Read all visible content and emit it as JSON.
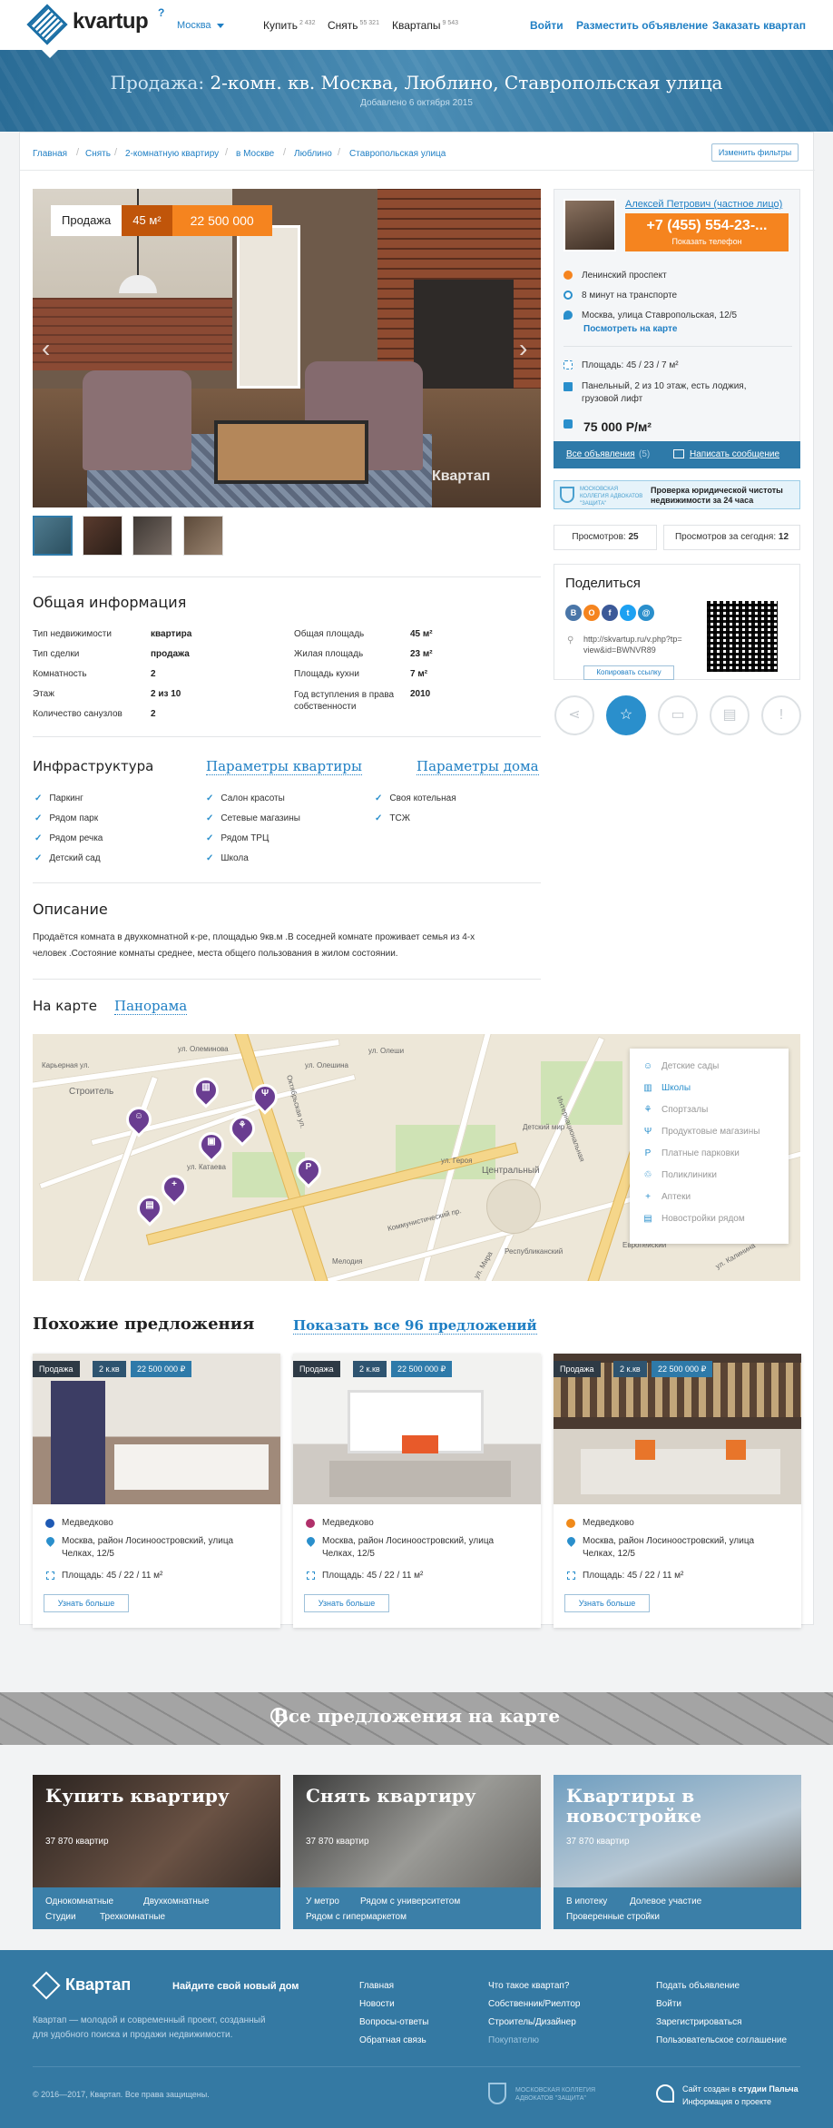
{
  "header": {
    "logo": "kvartup",
    "logo_mark": "?",
    "city": "Москва",
    "nav": [
      {
        "label": "Купить",
        "count": "2 432"
      },
      {
        "label": "Снять",
        "count": "55 321"
      },
      {
        "label": "Квартапы",
        "count": "9 543"
      }
    ],
    "links": [
      "Войти",
      "Разместить объявление",
      "Заказать квартап"
    ]
  },
  "hero": {
    "prefix": "Продажа:",
    "title": "2-комн. кв. Москва, Люблино, Ставропольская улица",
    "date": "Добавлено 6 октября 2015"
  },
  "breadcrumbs": [
    "Главная",
    "Снять",
    "2-комнатную квартиру",
    "в Москве",
    "Люблино",
    "Ставропольская улица"
  ],
  "filters_button": "Изменить фильтры",
  "photo": {
    "deal": "Продажа",
    "area": "45 м²",
    "price": "22 500 000",
    "watermark": "Квартап",
    "prev": "‹",
    "next": "›"
  },
  "agent": {
    "name": "Алексей Петрович (частное лицо)",
    "phone": "+7 (455) 554-23-...",
    "phone_hint": "Показать телефон",
    "metro": "Ленинский проспект",
    "transport": "8 минут на транспорте",
    "address": "Москва, улица Ставропольская, 12/5",
    "map_link": "Посмотреть на карте",
    "area": "Площадь: 45 / 23 / 7 м²",
    "building": "Панельный, 2 из 10 этаж, есть лоджия, грузовой лифт",
    "price_m2": "75 000 Р/м²",
    "all_ads": "Все объявления",
    "all_ads_count": "(5)",
    "write": "Написать сообщение"
  },
  "legal": {
    "logo": "МОСКОВСКАЯ КОЛЛЕГИЯ АДВОКАТОВ \"ЗАЩИТА\"",
    "text": "Проверка юридической чистоты недвижимости за 24 часа"
  },
  "views": {
    "total_label": "Просмотров:",
    "total": "25",
    "today_label": "Просмотров за сегодня:",
    "today": "12"
  },
  "share": {
    "title": "Поделиться",
    "url": "http://skvartup.ru/v.php?tp= view&id=BWNVR89",
    "copy": "Копировать ссылку",
    "icons": [
      "В",
      "О",
      "f",
      "t",
      "@"
    ]
  },
  "actions": [
    "share-icon",
    "star-icon",
    "car-icon",
    "note-icon",
    "alert-icon"
  ],
  "general": {
    "title": "Общая информация",
    "left": [
      [
        "Тип недвижимости",
        "квартира"
      ],
      [
        "Тип сделки",
        "продажа"
      ],
      [
        "Комнатность",
        "2"
      ],
      [
        "Этаж",
        "2 из 10"
      ],
      [
        "Количество санузлов",
        "2"
      ]
    ],
    "right": [
      [
        "Общая площадь",
        "45 м²"
      ],
      [
        "Жилая площадь",
        "23 м²"
      ],
      [
        "Площадь кухни",
        "7 м²"
      ],
      [
        "Год вступления в права собственности",
        "2010"
      ]
    ]
  },
  "infra": {
    "tabs": [
      "Инфраструктура",
      "Параметры квартиры",
      "Параметры дома"
    ],
    "col1": [
      "Паркинг",
      "Рядом парк",
      "Рядом речка",
      "Детский сад"
    ],
    "col2": [
      "Салон красоты",
      "Сетевые магазины",
      "Рядом ТРЦ",
      "Школа"
    ],
    "col3": [
      "Своя котельная",
      "ТСЖ"
    ]
  },
  "description": {
    "title": "Описание",
    "text": "Продаётся комната в двухкомнатной к-ре, площадью 9кв.м .В соседней комнате проживает семья из 4-х человек .Состояние комнаты среднее, места общего пользования в жилом состоянии."
  },
  "map": {
    "tabs": [
      "На карте",
      "Панорама"
    ],
    "legend": [
      "Детские сады",
      "Школы",
      "Спортзалы",
      "Продуктовые магазины",
      "Платные парковки",
      "Поликлиники",
      "Аптеки",
      "Новостройки рядом"
    ],
    "labels": [
      "ул. Олеши",
      "Строитель",
      "ул. Олеминова",
      "ул. Катаева",
      "Октябрьская ул.",
      "ул. Олешина",
      "ул. Героя",
      "Центральный",
      "Коммунистический пр.",
      "Интернациональная",
      "Детский мир",
      "Европейский",
      "Республиканский",
      "ул. Калинина",
      "ул. Мира",
      "Карьерная ул.",
      "Мелодия"
    ]
  },
  "similar": {
    "title": "Похожие предложения",
    "link": "Показать все 96 предложений",
    "items": [
      {
        "deal": "Продажа",
        "rooms": "2 к.кв",
        "price": "22 500 000 ₽",
        "metro": "Медведково",
        "metro_color": "#1f5ab4",
        "address": "Москва, район Лосиноостровский, улица Челках, 12/5",
        "area": "Площадь: 45 / 22 / 11 м²",
        "button": "Узнать больше"
      },
      {
        "deal": "Продажа",
        "rooms": "2 к.кв",
        "price": "22 500 000 ₽",
        "metro": "Медведково",
        "metro_color": "#b0306a",
        "address": "Москва, район Лосиноостровский, улица Челках, 12/5",
        "area": "Площадь: 45 / 22 / 11 м²",
        "button": "Узнать больше"
      },
      {
        "deal": "Продажа",
        "rooms": "2 к.кв",
        "price": "22 500 000 ₽",
        "metro": "Медведково",
        "metro_color": "#f08a1a",
        "address": "Москва, район Лосиноостровский, улица Челках, 12/5",
        "area": "Площадь: 45 / 22 / 11 м²",
        "button": "Узнать больше"
      }
    ]
  },
  "banner": "Все предложения на карте",
  "categories": [
    {
      "title": "Купить квартиру",
      "count": "37 870 квартир",
      "links": [
        "Однокомнатные",
        "Двухкомнатные",
        "Студии",
        "Трехкомнатные"
      ]
    },
    {
      "title": "Снять квартиру",
      "count": "37 870 квартир",
      "links": [
        "У метро",
        "Рядом с университетом",
        "Рядом с гипермаркетом"
      ]
    },
    {
      "title": "Квартиры в новостройке",
      "count": "37 870 квартир",
      "links": [
        "В ипотеку",
        "Долевое участие",
        "Проверенные стройки"
      ]
    }
  ],
  "footer": {
    "logo": "Квартап",
    "slogan": "Найдите свой новый дом",
    "about": "Квартап — молодой и современный проект, созданный для удобного поиска и продажи недвижимости.",
    "col1": [
      "Главная",
      "Новости",
      "Вопросы-ответы",
      "Обратная связь"
    ],
    "col2": [
      "Что такое квартап?",
      "Собственник/Риелтор",
      "Строитель/Дизайнер",
      "Покупателю"
    ],
    "col3": [
      "Подать объявление",
      "Войти",
      "Зарегистрироваться",
      "Пользовательское соглашение"
    ],
    "copyright": "© 2016—2017, Квартап. Все права защищены.",
    "partner": "МОСКОВСКАЯ КОЛЛЕГИЯ АДВОКАТОВ \"ЗАЩИТА\"",
    "made_prefix": "Сайт создан в",
    "made_studio": "студии Пальча",
    "made_info": "Информация о проекте"
  }
}
